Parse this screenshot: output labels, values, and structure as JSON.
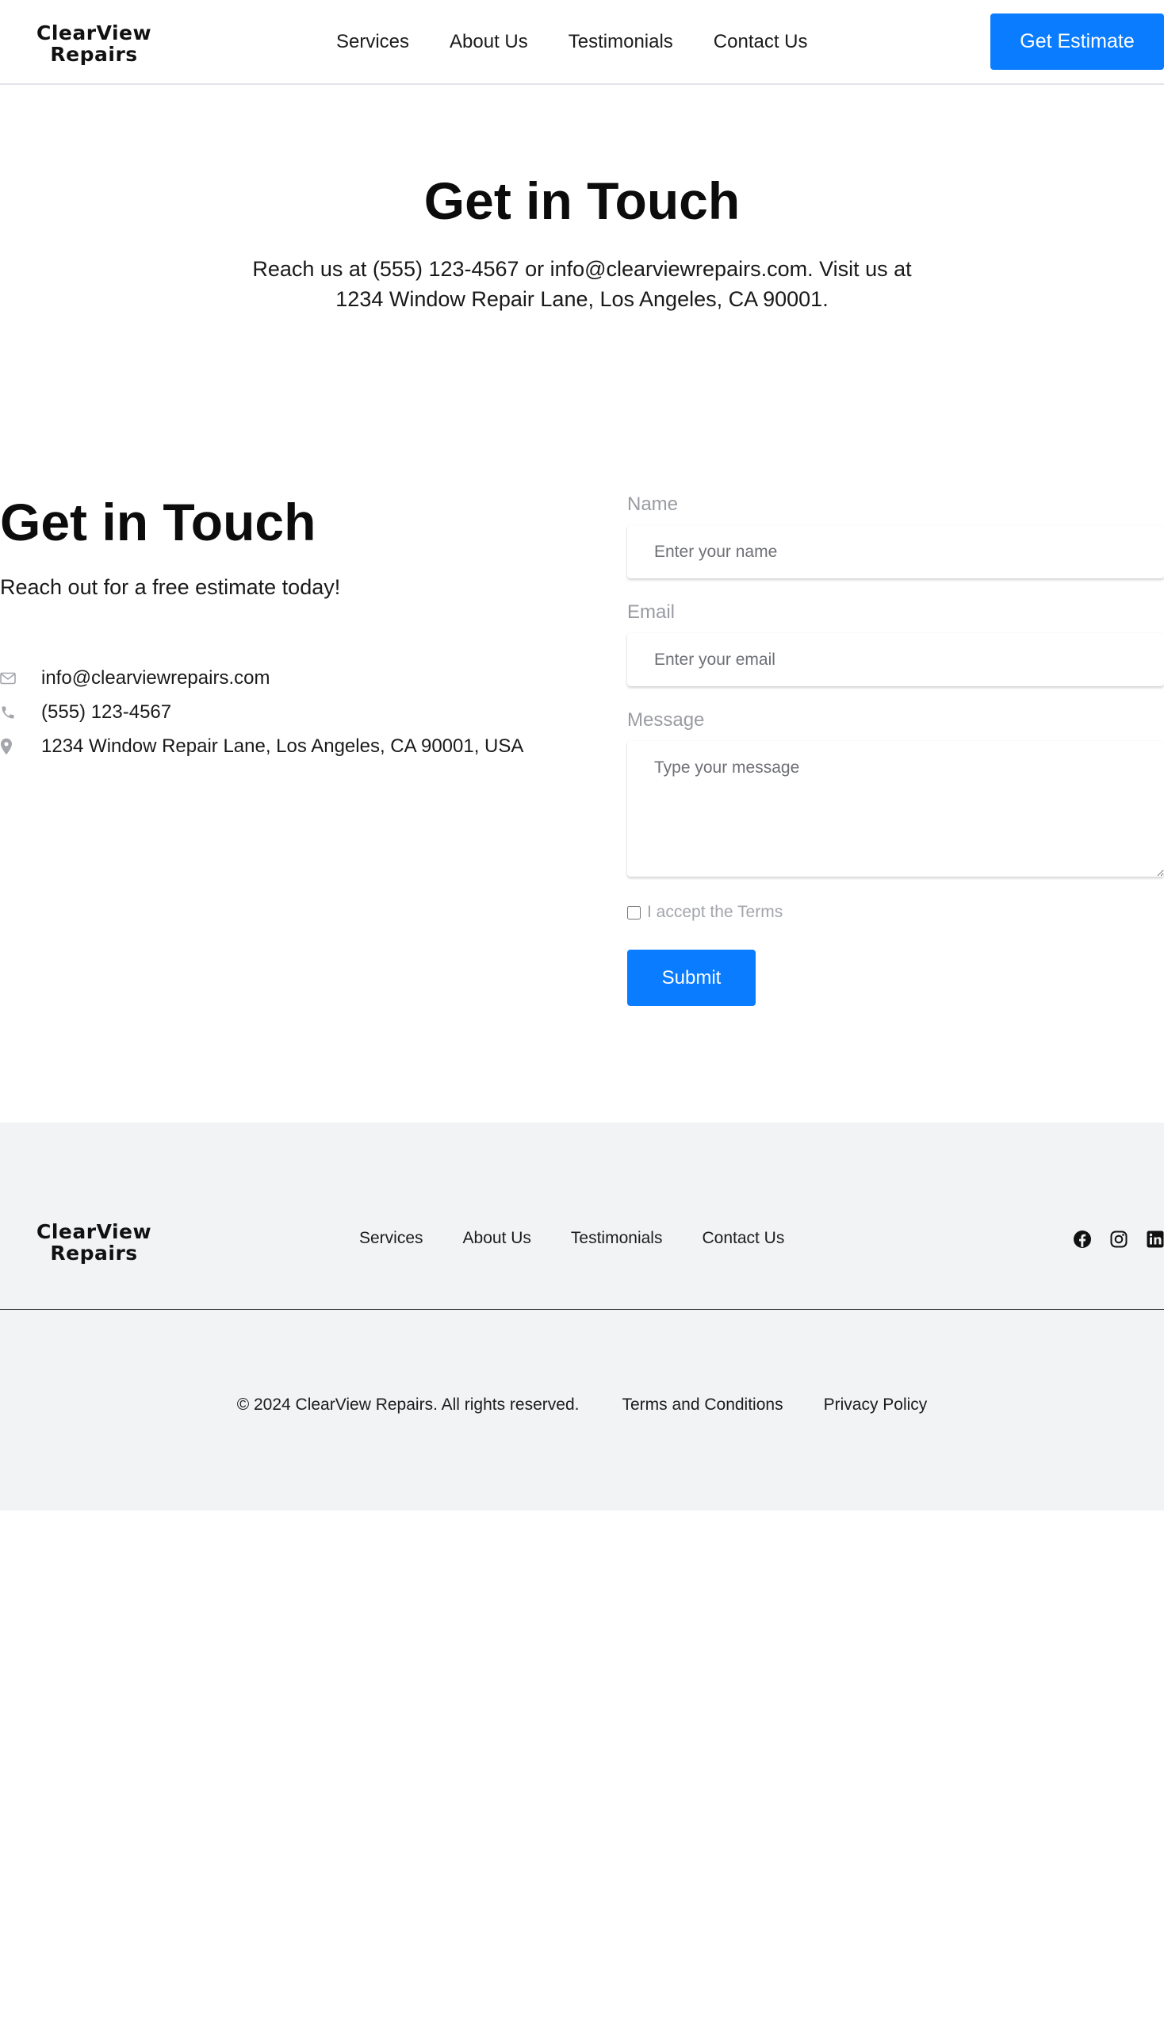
{
  "brand": {
    "logo_line1": "ClearView",
    "logo_line2": "Repairs"
  },
  "header": {
    "nav": [
      "Services",
      "About Us",
      "Testimonials",
      "Contact Us"
    ],
    "cta_label": "Get Estimate"
  },
  "hero": {
    "title": "Get in Touch",
    "text": "Reach us at (555) 123-4567 or info@clearviewrepairs.com. Visit us at 1234 Window Repair Lane, Los Angeles, CA 90001."
  },
  "contact": {
    "title": "Get in Touch",
    "subtitle": "Reach out for a free estimate today!",
    "info": [
      {
        "icon": "envelope-icon",
        "text": "info@clearviewrepairs.com"
      },
      {
        "icon": "phone-icon",
        "text": "(555) 123-4567"
      },
      {
        "icon": "map-pin-icon",
        "text": "1234 Window Repair Lane, Los Angeles, CA 90001, USA"
      }
    ]
  },
  "form": {
    "name_label": "Name",
    "name_placeholder": "Enter your name",
    "email_label": "Email",
    "email_placeholder": "Enter your email",
    "message_label": "Message",
    "message_placeholder": "Type your message",
    "terms_label": "I accept the Terms",
    "terms_checked": false,
    "submit_label": "Submit"
  },
  "footer": {
    "nav": [
      "Services",
      "About Us",
      "Testimonials",
      "Contact Us"
    ],
    "social": [
      "facebook-icon",
      "instagram-icon",
      "linkedin-icon"
    ],
    "copyright": "© 2024 ClearView Repairs. All rights reserved.",
    "terms_link": "Terms and Conditions",
    "privacy_link": "Privacy Policy"
  },
  "colors": {
    "accent": "#0a7cff",
    "footer_bg": "#f2f3f5",
    "muted_text": "#9a9ca2"
  }
}
